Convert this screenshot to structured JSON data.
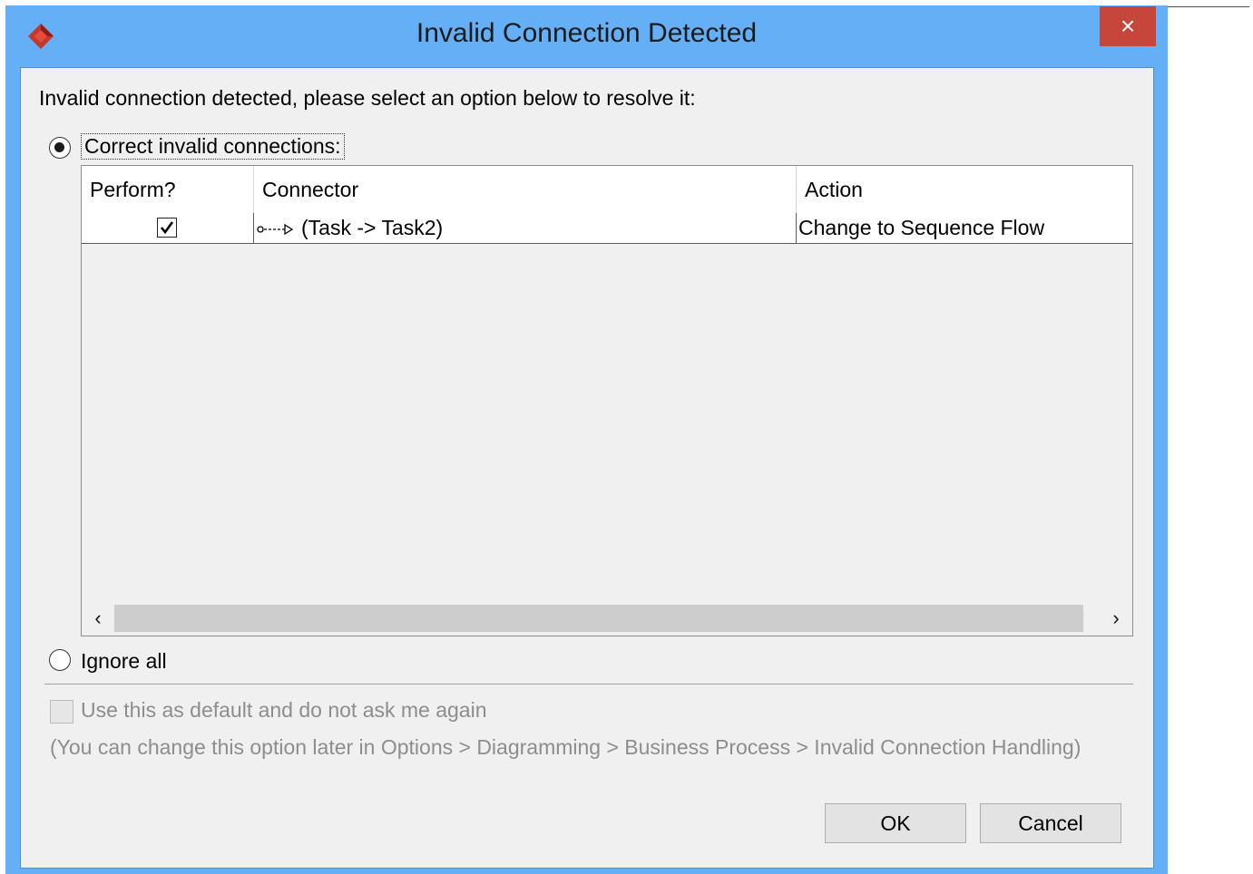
{
  "window": {
    "title": "Invalid Connection Detected",
    "close_label": "×",
    "accent_color": "#64aff6",
    "close_color": "#c7463b"
  },
  "dialog": {
    "instruction": "Invalid connection detected, please select an option below to resolve it:",
    "options": {
      "correct_label": "Correct invalid connections:",
      "correct_selected": true,
      "ignore_label": "Ignore all",
      "ignore_selected": false
    },
    "table": {
      "headers": [
        "Perform?",
        "Connector",
        "Action"
      ],
      "rows": [
        {
          "perform": true,
          "connector": "(Task -> Task2)",
          "connector_icon": "message-flow-icon",
          "action": "Change to Sequence Flow"
        }
      ]
    },
    "scrollbar": {
      "left_glyph": "‹",
      "right_glyph": "›"
    },
    "default_option": {
      "label": "Use this as default and do not ask me again",
      "checked": false,
      "enabled": false
    },
    "hint": "(You can change this option later in Options > Diagramming > Business Process > Invalid Connection Handling)",
    "buttons": {
      "ok": "OK",
      "cancel": "Cancel"
    }
  }
}
